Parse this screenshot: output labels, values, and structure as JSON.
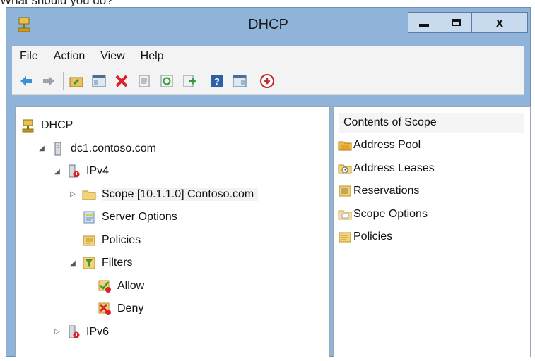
{
  "caption": "What should you do?",
  "window": {
    "title": "DHCP",
    "controls": {
      "minimize": "minimize",
      "maximize": "maximize",
      "close": "x"
    }
  },
  "menu": [
    "File",
    "Action",
    "View",
    "Help"
  ],
  "toolbar": {
    "icons": [
      "back-arrow-icon",
      "forward-arrow-icon",
      "up-folder-icon",
      "show-hide-tree-icon",
      "delete-icon",
      "properties-icon",
      "refresh-icon",
      "export-list-icon",
      "help-icon",
      "action-pane-icon",
      "stop-icon"
    ]
  },
  "tree": [
    {
      "label": "DHCP",
      "level": 0,
      "expander": "",
      "icon": "dhcp-root-icon"
    },
    {
      "label": "dc1.contoso.com",
      "level": 1,
      "expander": "expanded",
      "icon": "server-icon"
    },
    {
      "label": "IPv4",
      "level": 2,
      "expander": "expanded",
      "icon": "ipv4-icon"
    },
    {
      "label": "Scope [10.1.1.0] Contoso.com",
      "level": 3,
      "expander": "collapsed",
      "icon": "scope-folder-icon",
      "selected": true
    },
    {
      "label": "Server Options",
      "level": 3,
      "expander": "",
      "icon": "server-options-icon"
    },
    {
      "label": "Policies",
      "level": 3,
      "expander": "",
      "icon": "policies-icon"
    },
    {
      "label": "Filters",
      "level": 3,
      "expander": "expanded",
      "icon": "filters-icon"
    },
    {
      "label": "Allow",
      "level": 4,
      "expander": "",
      "icon": "allow-filter-icon"
    },
    {
      "label": "Deny",
      "level": 4,
      "expander": "",
      "icon": "deny-filter-icon"
    },
    {
      "label": "IPv6",
      "level": 2,
      "expander": "collapsed",
      "icon": "ipv6-icon"
    }
  ],
  "contents": {
    "header": "Contents of Scope",
    "items": [
      {
        "label": "Address Pool",
        "icon": "address-pool-icon"
      },
      {
        "label": "Address Leases",
        "icon": "address-leases-icon"
      },
      {
        "label": "Reservations",
        "icon": "reservations-icon"
      },
      {
        "label": "Scope Options",
        "icon": "scope-options-icon"
      },
      {
        "label": "Policies",
        "icon": "policies-icon"
      }
    ]
  }
}
